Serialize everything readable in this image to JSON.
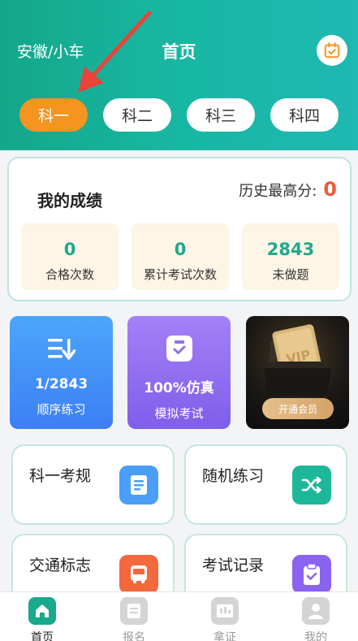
{
  "header": {
    "location": "安徽/小车",
    "title": "首页",
    "calendar_icon": "calendar-check-icon"
  },
  "subject_tabs": [
    {
      "label": "科一",
      "active": true
    },
    {
      "label": "科二",
      "active": false
    },
    {
      "label": "科三",
      "active": false
    },
    {
      "label": "科四",
      "active": false
    }
  ],
  "score": {
    "title": "我的成绩",
    "best_label": "历史最高分:",
    "best_value": "0",
    "stats": [
      {
        "value": "0",
        "label": "合格次数"
      },
      {
        "value": "0",
        "label": "累计考试次数"
      },
      {
        "value": "2843",
        "label": "未做题"
      }
    ]
  },
  "features": [
    {
      "value": "1/2843",
      "label": "顺序练习",
      "icon": "list-sort-icon"
    },
    {
      "value": "100%仿真",
      "label": "模拟考试",
      "icon": "exam-check-icon"
    },
    {
      "button": "开通会员",
      "icon": "vip-card-icon"
    }
  ],
  "grid": [
    {
      "label": "科一考规",
      "icon": "document-icon",
      "color": "#4b9ef5"
    },
    {
      "label": "随机练习",
      "icon": "shuffle-icon",
      "color": "#1db89a"
    },
    {
      "label": "交通标志",
      "icon": "bus-icon",
      "color": "#f3683c"
    },
    {
      "label": "考试记录",
      "icon": "clipboard-check-icon",
      "color": "#8a63ef"
    }
  ],
  "bottom_nav": [
    {
      "label": "首页",
      "icon": "home-icon",
      "active": true
    },
    {
      "label": "报名",
      "icon": "form-icon",
      "active": false
    },
    {
      "label": "拿证",
      "icon": "license-icon",
      "active": false
    },
    {
      "label": "我的",
      "icon": "user-icon",
      "active": false
    }
  ],
  "colors": {
    "brand": "#19a98c",
    "accent": "#f5941f",
    "best_score": "#ee5a3a"
  }
}
